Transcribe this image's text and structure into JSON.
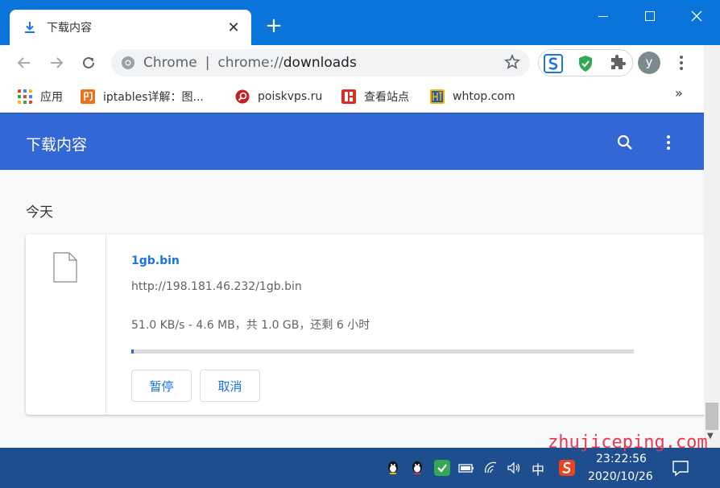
{
  "browser": {
    "tab_title": "下载内容",
    "tab_close": "✕",
    "new_tab": "+",
    "window_controls": {
      "minimize": "—",
      "maximize": "☐",
      "close": "✕"
    }
  },
  "toolbar": {
    "omnibox_scheme": "Chrome",
    "omnibox_separator": "|",
    "omnibox_url_prefix": "chrome://",
    "omnibox_url_host": "downloads",
    "avatar_letter": "y"
  },
  "bookmarks": {
    "items": [
      {
        "label": "应用",
        "icon": "apps-grid-icon"
      },
      {
        "label": "iptables详解：图...",
        "icon": "yin-icon"
      },
      {
        "label": "poiskvps.ru",
        "icon": "search-red-icon"
      },
      {
        "label": "查看站点",
        "icon": "seal-icon"
      },
      {
        "label": "whtop.com",
        "icon": "whtop-icon"
      }
    ],
    "more": "»"
  },
  "downloads": {
    "title": "下载内容",
    "date_heading": "今天",
    "item": {
      "file_name": "1gb.bin",
      "url": "http://198.181.46.232/1gb.bin",
      "status": "51.0 KB/s - 4.6 MB，共 1.0 GB，还剩 6 小时",
      "progress_fraction": 0.0046,
      "pause_label": "暂停",
      "cancel_label": "取消"
    }
  },
  "taskbar": {
    "ime": "中",
    "time": "23:22:56",
    "date": "2020/10/26"
  },
  "watermark": "zhujiceping.com",
  "colors": {
    "titlebar": "#0a74da",
    "header": "#3367d6",
    "link": "#1a73e8",
    "taskbar": "#1f4e8f"
  }
}
